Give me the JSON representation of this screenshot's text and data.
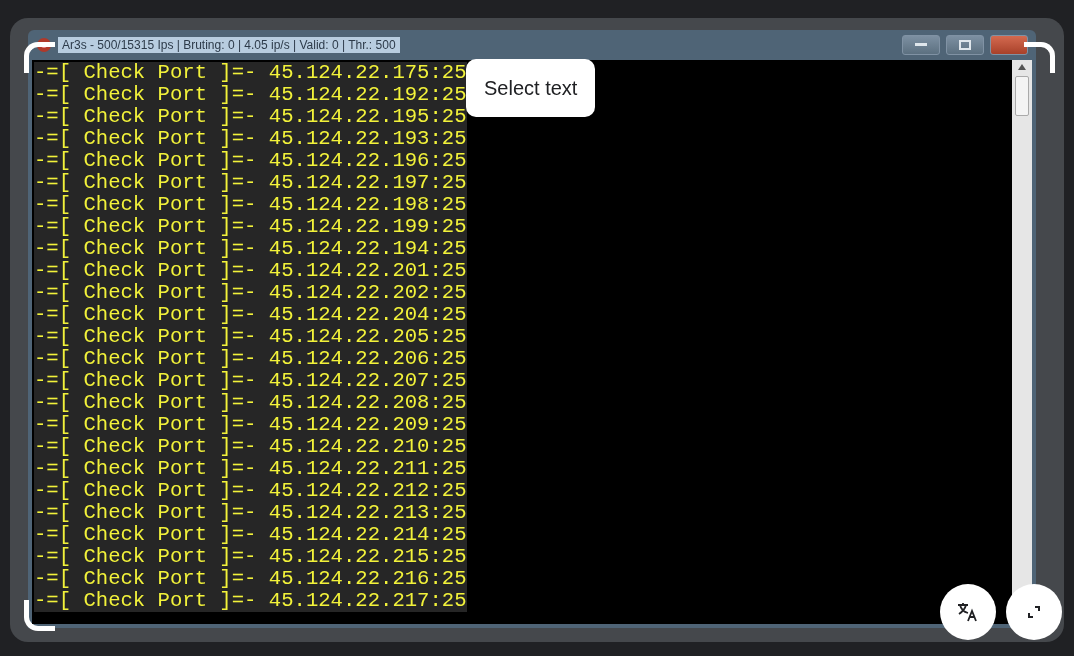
{
  "window": {
    "title": "Ar3s - 500/15315 Ips | Bruting: 0 | 4.05 ip/s | Valid: 0 | Thr.: 500"
  },
  "console_lines": [
    "-=[ Check Port ]=- 45.124.22.175:25",
    "-=[ Check Port ]=- 45.124.22.192:25",
    "-=[ Check Port ]=- 45.124.22.195:25",
    "-=[ Check Port ]=- 45.124.22.193:25",
    "-=[ Check Port ]=- 45.124.22.196:25",
    "-=[ Check Port ]=- 45.124.22.197:25",
    "-=[ Check Port ]=- 45.124.22.198:25",
    "-=[ Check Port ]=- 45.124.22.199:25",
    "-=[ Check Port ]=- 45.124.22.194:25",
    "-=[ Check Port ]=- 45.124.22.201:25",
    "-=[ Check Port ]=- 45.124.22.202:25",
    "-=[ Check Port ]=- 45.124.22.204:25",
    "-=[ Check Port ]=- 45.124.22.205:25",
    "-=[ Check Port ]=- 45.124.22.206:25",
    "-=[ Check Port ]=- 45.124.22.207:25",
    "-=[ Check Port ]=- 45.124.22.208:25",
    "-=[ Check Port ]=- 45.124.22.209:25",
    "-=[ Check Port ]=- 45.124.22.210:25",
    "-=[ Check Port ]=- 45.124.22.211:25",
    "-=[ Check Port ]=- 45.124.22.212:25",
    "-=[ Check Port ]=- 45.124.22.213:25",
    "-=[ Check Port ]=- 45.124.22.214:25",
    "-=[ Check Port ]=- 45.124.22.215:25",
    "-=[ Check Port ]=- 45.124.22.216:25",
    "-=[ Check Port ]=- 45.124.22.217:25"
  ],
  "lens": {
    "chip": "Select text"
  }
}
